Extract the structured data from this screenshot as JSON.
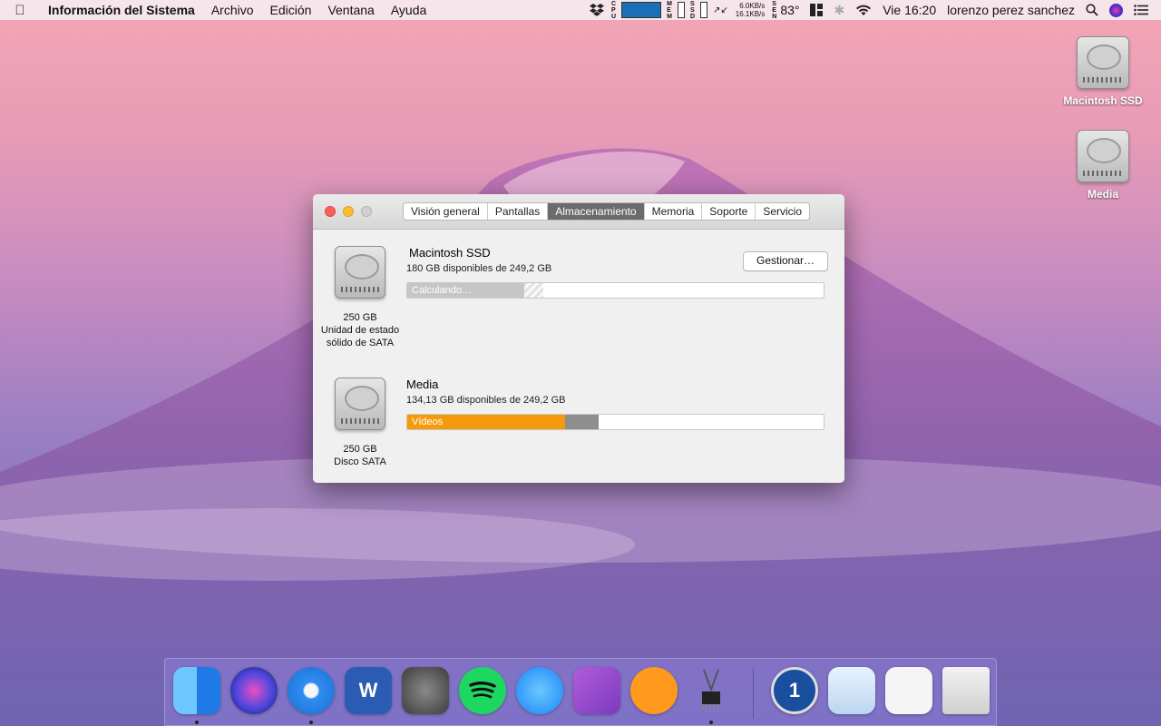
{
  "menubar": {
    "app_name": "Información del Sistema",
    "menus": [
      "Archivo",
      "Edición",
      "Ventana",
      "Ayuda"
    ],
    "status": {
      "net_up": "6.0KB/s",
      "net_down": "16.1KB/s",
      "temperature": "83°",
      "clock": "Vie 16:20",
      "user": "lorenzo perez sanchez",
      "cpu_label": [
        "C",
        "P",
        "U"
      ],
      "mem_label": [
        "M",
        "E",
        "M"
      ],
      "ssd_label": [
        "S",
        "S",
        "D"
      ],
      "sen_label": [
        "S",
        "E",
        "N"
      ]
    }
  },
  "desktop": {
    "icons": [
      {
        "label": "Macintosh SSD"
      },
      {
        "label": "Media"
      }
    ]
  },
  "window": {
    "tabs": [
      "Visión general",
      "Pantallas",
      "Almacenamiento",
      "Memoria",
      "Soporte",
      "Servicio"
    ],
    "active_tab": "Almacenamiento",
    "manage_button": "Gestionar…",
    "disks": [
      {
        "name": "Macintosh SSD",
        "available": "180 GB disponibles de 249,2 GB",
        "capacity": "250 GB",
        "type": "Unidad de estado sólido de SATA",
        "bar_label": "Calculando…",
        "used_fraction": 0.28
      },
      {
        "name": "Media",
        "available": "134,13 GB disponibles de 249,2 GB",
        "capacity": "250 GB",
        "type": "Disco SATA",
        "bar_label": "Vídeos",
        "videos_fraction": 0.38,
        "other_fraction": 0.08
      }
    ]
  },
  "colors": {
    "videos": "#f59b0b",
    "other": "#8e8e8e",
    "calculating": "#c6c6c6",
    "active_tab": "#6b6b6b"
  },
  "dock": {
    "items": [
      {
        "icon": "finder-icon",
        "running": true
      },
      {
        "icon": "siri-icon",
        "running": false
      },
      {
        "icon": "safari-icon",
        "running": true
      },
      {
        "icon": "word-icon",
        "running": false,
        "glyph": "W"
      },
      {
        "icon": "system-preferences-icon",
        "running": false
      },
      {
        "icon": "spotify-icon",
        "running": false
      },
      {
        "icon": "messages-icon",
        "running": false
      },
      {
        "icon": "omnifocus-icon",
        "running": false
      },
      {
        "icon": "ibooks-icon",
        "running": false
      },
      {
        "icon": "system-information-icon",
        "running": true
      },
      {
        "icon": "1password-icon",
        "running": false,
        "glyph": "1"
      },
      {
        "icon": "applications-folder-icon",
        "running": false
      },
      {
        "icon": "downloads-stack-icon",
        "running": false
      },
      {
        "icon": "trash-icon",
        "running": false
      }
    ]
  }
}
